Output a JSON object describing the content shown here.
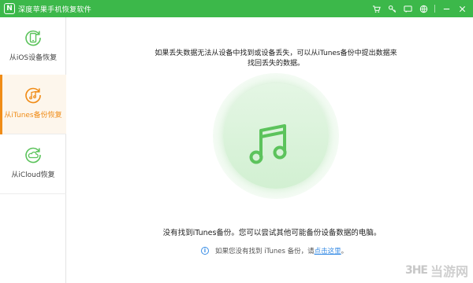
{
  "titlebar": {
    "app_title": "深度苹果手机恢复软件",
    "logo_glyph": "N",
    "icons": [
      "cart-icon",
      "key-icon",
      "feedback-icon",
      "globe-icon",
      "minimize-icon",
      "close-icon"
    ],
    "background": "#3cb84a"
  },
  "sidebar": {
    "items": [
      {
        "label": "从iOS设备恢复",
        "icon": "phone-refresh-icon",
        "active": false
      },
      {
        "label": "从iTunes备份恢复",
        "icon": "music-refresh-icon",
        "active": true
      },
      {
        "label": "从iCloud恢复",
        "icon": "cloud-refresh-icon",
        "active": false
      }
    ],
    "accent": "#f08c17"
  },
  "main": {
    "description": "如果丢失数据无法从设备中找到或设备丢失，可以从iTunes备份中提出数据来找回丢失的数据。",
    "status": "没有找到iTunes备份。您可以尝试其他可能备份设备数据的电脑。",
    "hint_prefix": "如果您没有找到 iTunes 备份，请",
    "hint_link": "点击这里",
    "hint_suffix": "。",
    "icon": "music-note-icon",
    "accent": "#5cc35c"
  },
  "watermark": {
    "logo": "3HE",
    "text": "当游网"
  }
}
